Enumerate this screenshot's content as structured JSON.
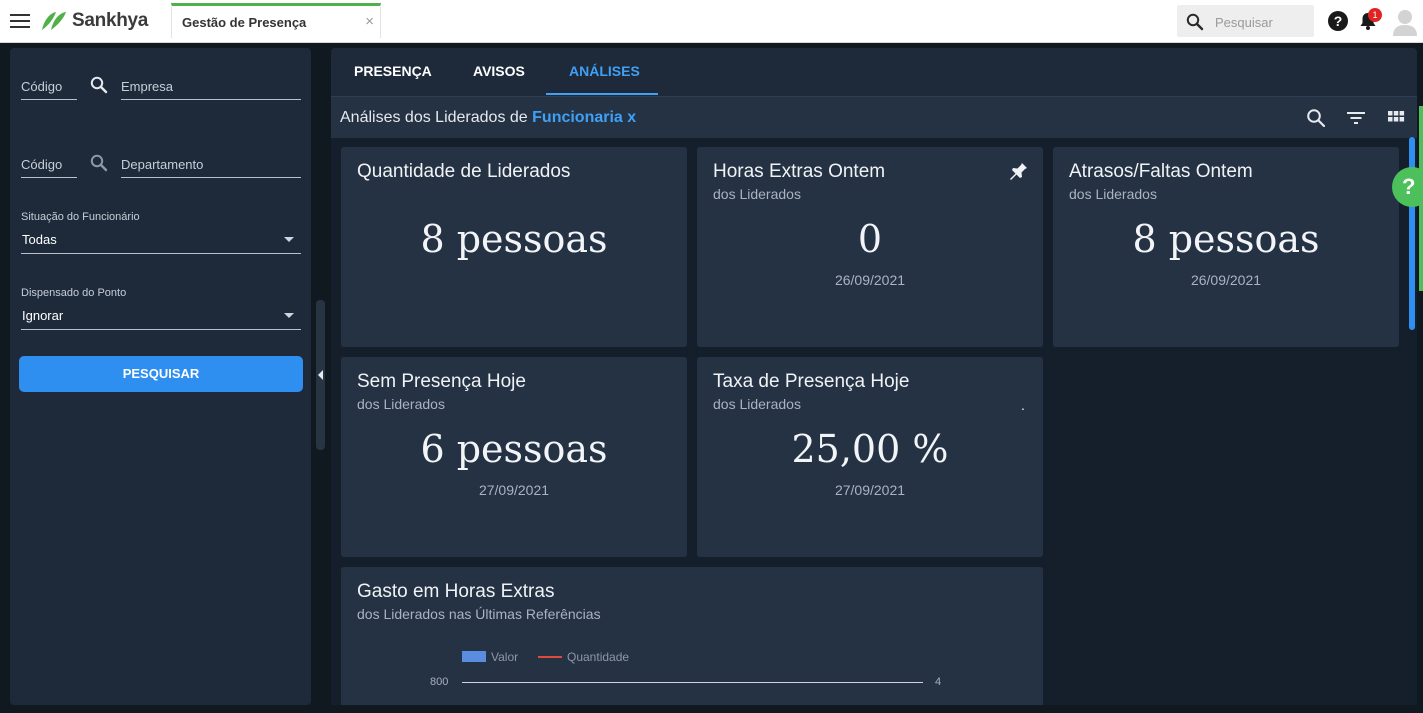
{
  "app": {
    "brand": "Sankhya",
    "tab_title": "Gestão de Presença",
    "tab_close": "×",
    "search_placeholder": "Pesquisar",
    "help": "?",
    "notification_count": "1"
  },
  "filters": {
    "empresa_code_label": "Código",
    "empresa_label": "Empresa",
    "departamento_code_label": "Código",
    "departamento_label": "Departamento",
    "situacao_caption": "Situação do Funcionário",
    "situacao_value": "Todas",
    "dispensado_caption": "Dispensado do Ponto",
    "dispensado_value": "Ignorar",
    "search_button": "PESQUISAR"
  },
  "tabs": [
    {
      "label": "PRESENÇA",
      "active": false
    },
    {
      "label": "AVISOS",
      "active": false
    },
    {
      "label": "ANÁLISES",
      "active": true
    }
  ],
  "subheader": {
    "prefix": "Análises dos Liderados de",
    "name": "Funcionaria x"
  },
  "cards": {
    "liderados": {
      "title": "Quantidade de Liderados",
      "value": "8 pessoas"
    },
    "horas_extras": {
      "title": "Horas Extras Ontem",
      "subtitle": "dos Liderados",
      "value": "0",
      "date": "26/09/2021"
    },
    "atrasos": {
      "title": "Atrasos/Faltas Ontem",
      "subtitle": "dos Liderados",
      "value": "8 pessoas",
      "date": "26/09/2021"
    },
    "sem_presenca": {
      "title": "Sem Presença Hoje",
      "subtitle": "dos Liderados",
      "value": "6 pessoas",
      "date": "27/09/2021"
    },
    "taxa": {
      "title": "Taxa de Presença Hoje",
      "subtitle": "dos Liderados",
      "value": "25,00 %",
      "date": "27/09/2021",
      "marker": "."
    },
    "gasto": {
      "title": "Gasto em Horas Extras",
      "subtitle": "dos Liderados nas Últimas Referências"
    }
  },
  "chart_data": {
    "type": "bar",
    "title": "Gasto em Horas Extras",
    "subtitle": "dos Liderados nas Últimas Referências",
    "series": [
      {
        "name": "Valor",
        "type": "bar",
        "color": "#5a8de0"
      },
      {
        "name": "Quantidade",
        "type": "line",
        "color": "#e04a3a"
      }
    ],
    "y_left_ticks": [
      "800"
    ],
    "y_right_ticks": [
      "4"
    ],
    "legend": "top",
    "grid": true
  },
  "colors": {
    "accent": "#3fa0f5",
    "button": "#2e8ff0",
    "card": "#243244",
    "brand_green": "#52b04a"
  }
}
